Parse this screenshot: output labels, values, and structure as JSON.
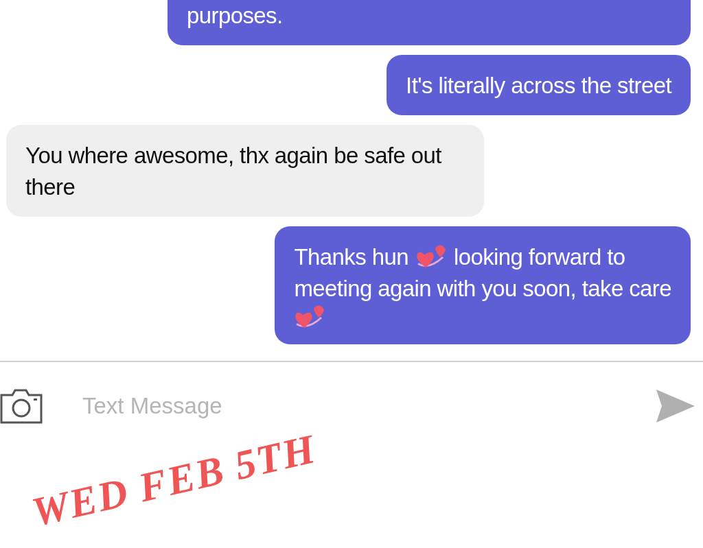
{
  "messages": [
    {
      "kind": "sent",
      "lines": [
        [
          {
            "kind": "text",
            "text": "purposes."
          }
        ]
      ]
    },
    {
      "kind": "sent",
      "lines": [
        [
          {
            "kind": "text",
            "text": "It's literally across the street"
          }
        ]
      ]
    },
    {
      "kind": "received",
      "lines": [
        [
          {
            "kind": "text",
            "text": "You where awesome, thx again be safe out there"
          }
        ]
      ]
    },
    {
      "kind": "sent",
      "lines": [
        [
          {
            "kind": "text",
            "text": "Thanks hun"
          },
          {
            "kind": "emoji"
          },
          {
            "kind": "text",
            "text": "looking forward to"
          }
        ],
        [
          {
            "kind": "text",
            "text": "meeting again with you soon, take care"
          }
        ],
        [
          {
            "kind": "emoji"
          }
        ]
      ]
    }
  ],
  "composer": {
    "placeholder": "Text Message"
  },
  "annotation": {
    "text": "WED FEB 5TH"
  }
}
